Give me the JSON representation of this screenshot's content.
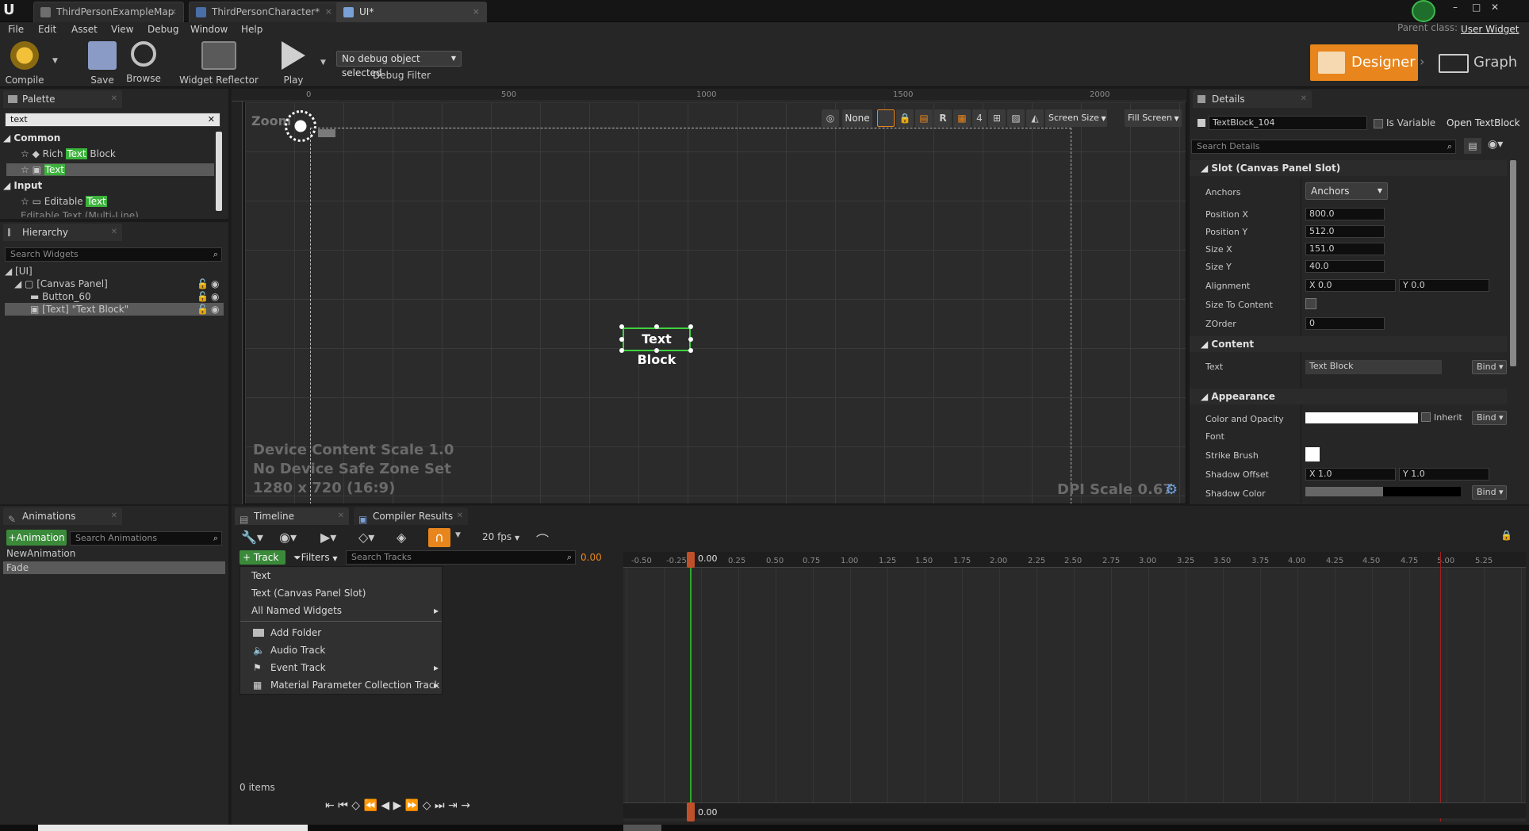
{
  "titlebar": {
    "tabs": [
      {
        "label": "ThirdPersonExampleMap",
        "x": "×"
      },
      {
        "label": "ThirdPersonCharacter*",
        "x": "×"
      },
      {
        "label": "UI*",
        "x": "×"
      }
    ],
    "parent_class_label": "Parent class:",
    "parent_class_value": "User Widget"
  },
  "menubar": [
    "File",
    "Edit",
    "Asset",
    "View",
    "Debug",
    "Window",
    "Help"
  ],
  "toolbar": {
    "compile": "Compile",
    "save": "Save",
    "browse": "Browse",
    "widget_reflector": "Widget Reflector",
    "play": "Play",
    "debug_select": "No debug object selected",
    "debug_filter": "Debug Filter",
    "designer": "Designer",
    "graph": "Graph"
  },
  "palette": {
    "title": "Palette",
    "search": "text",
    "common": "Common",
    "rich_pre": "Rich ",
    "rich_hl": "Text",
    "rich_post": " Block",
    "text_item": "Text",
    "input": "Input",
    "editable_pre": "Editable ",
    "editable_hl": "Text",
    "editable_multi": "Editable Text (Multi-Line)"
  },
  "hierarchy": {
    "title": "Hierarchy",
    "search_placeholder": "Search Widgets",
    "root": "[UI]",
    "canvas": "[Canvas Panel]",
    "button": "Button_60",
    "textblock": "[Text] \"Text Block\""
  },
  "canvas": {
    "zoom": "Zoom",
    "ruler": [
      "0",
      "500",
      "1000",
      "1500",
      "2000"
    ],
    "none_btn": "None",
    "r_btn": "R",
    "four_btn": "4",
    "screen_size": "Screen Size",
    "fill_screen": "Fill Screen",
    "info1": "Device Content Scale 1.0",
    "info2": "No Device Safe Zone Set",
    "info3": "1280 x 720 (16:9)",
    "dpi": "DPI Scale 0.67",
    "text_block": "Text Block"
  },
  "details": {
    "title": "Details",
    "name": "TextBlock_104",
    "is_variable": "Is Variable",
    "open_link": "Open TextBlock",
    "search_placeholder": "Search Details",
    "slot_section": "Slot (Canvas Panel Slot)",
    "anchors_label": "Anchors",
    "anchors_value": "Anchors",
    "pos_x_label": "Position X",
    "pos_x": "800.0",
    "pos_y_label": "Position Y",
    "pos_y": "512.0",
    "size_x_label": "Size X",
    "size_x": "151.0",
    "size_y_label": "Size Y",
    "size_y": "40.0",
    "alignment_label": "Alignment",
    "align_x": "X  0.0",
    "align_y": "Y  0.0",
    "size_to_content": "Size To Content",
    "zorder_label": "ZOrder",
    "zorder": "0",
    "content_section": "Content",
    "text_label": "Text",
    "text_value": "Text Block",
    "bind": "Bind",
    "appearance_section": "Appearance",
    "color_label": "Color and Opacity",
    "inherit": "Inherit",
    "font_label": "Font",
    "strike_label": "Strike Brush",
    "shadow_offset_label": "Shadow Offset",
    "shadow_x": "X  1.0",
    "shadow_y": "Y  1.0",
    "shadow_color_label": "Shadow Color"
  },
  "animations": {
    "title": "Animations",
    "add": "+Animation",
    "search_placeholder": "Search Animations",
    "items": [
      "NewAnimation",
      "Fade"
    ]
  },
  "timeline": {
    "tab": "Timeline",
    "compiler_tab": "Compiler Results",
    "fps": "20 fps",
    "track_btn": "+ Track",
    "filters_btn": "Filters",
    "search_placeholder": "Search Tracks",
    "time_value": "0.00",
    "playhead": "0.00",
    "items_count": "0 items",
    "ticks": [
      "-0.50",
      "-0.25",
      "0.25",
      "0.50",
      "0.75",
      "1.00",
      "1.25",
      "1.50",
      "1.75",
      "2.00",
      "2.25",
      "2.50",
      "2.75",
      "3.00",
      "3.25",
      "3.50",
      "3.75",
      "4.00",
      "4.25",
      "4.50",
      "4.75",
      "5.00",
      "5.25"
    ],
    "menu": {
      "text": "Text",
      "slot": "Text (Canvas Panel Slot)",
      "named": "All Named Widgets",
      "folder": "Add Folder",
      "audio": "Audio Track",
      "event": "Event Track",
      "mpc": "Material Parameter Collection Track"
    }
  },
  "colors": {
    "accent": "#e8851c",
    "highlight": "#3bb33b",
    "selection": "#5a5a5a"
  }
}
